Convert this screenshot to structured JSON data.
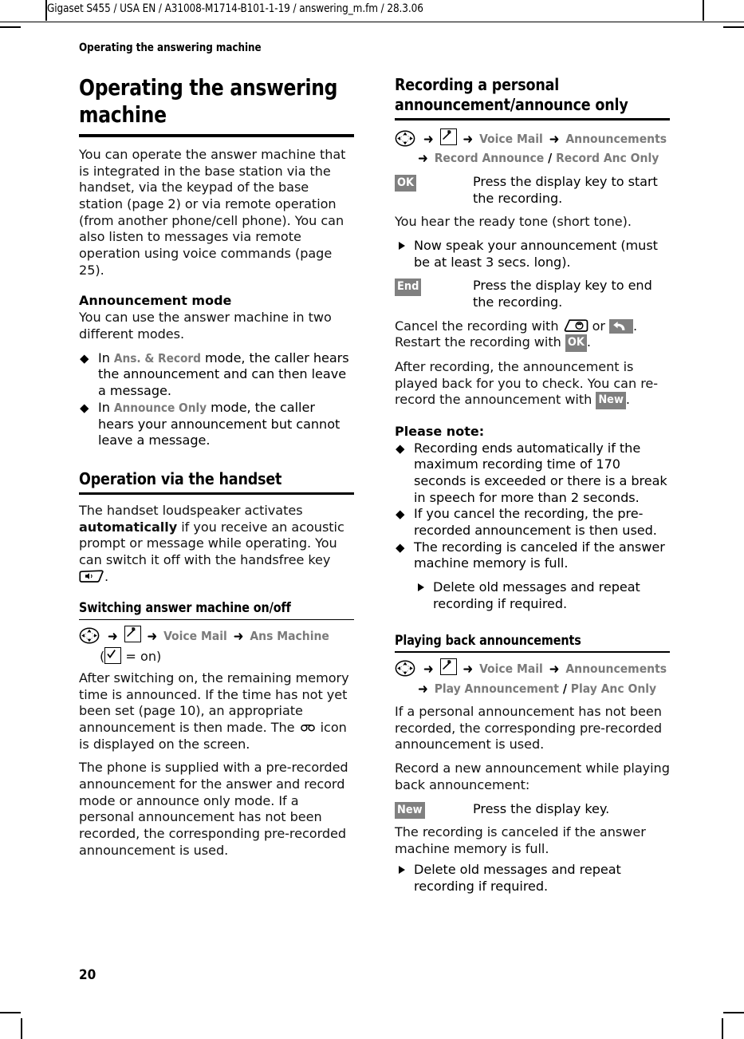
{
  "runhead": {
    "text": "Gigaset S455 / USA EN / A31008-M1714-B101-1-19  / answering_m.fm / 28.3.06"
  },
  "chapter": "Operating the answering machine",
  "folio": "20",
  "left_column": {
    "h1": "Operating the answering machine",
    "intro": "You can operate the answer machine that is integrated in the base station via the handset, via the keypad of the base station (page 2) or via remote operation (from another phone/cell phone). You can also listen to messages via remote operation using voice commands (page 25).",
    "announcement_mode": {
      "heading": "Announcement mode",
      "intro": "You can use the answer machine in two different modes.",
      "bullets": [
        {
          "pre": "In ",
          "ui": "Ans. & Record",
          "post": " mode, the caller hears the announcement and can then leave a message."
        },
        {
          "pre": "In ",
          "ui": "Announce Only",
          "post": " mode, the caller hears your announcement but cannot leave a message."
        }
      ]
    },
    "handset_section": {
      "heading": "Operation via the handset",
      "para_a": "The handset loudspeaker activates ",
      "para_a_bold": "automatically",
      "para_a_cont": " if you receive an acoustic prompt or message while operating. You can switch it off with the handsfree key ",
      "para_a_end": "."
    },
    "switching_section": {
      "heading": "Switching answer machine on/off",
      "menupath": {
        "item1": "Voice Mail",
        "item2": "Ans Machine",
        "note_open": "(",
        "note_text": " = on)"
      },
      "para_b_1": "After switching on, the remaining memory time is announced. If the time has not yet been set (page 10), an appropriate announcement is then made. The ",
      "para_b_2": " icon is displayed on the screen.",
      "para_c": "The phone is supplied with a pre-recorded announcement for the answer and record mode or announce only mode. If a personal announcement has not been recorded, the corresponding pre-recorded announcement is used."
    }
  },
  "right_column": {
    "recording_section": {
      "heading": "Recording a personal announcement/announce only",
      "menupath": {
        "item1": "Voice Mail",
        "item2": "Announcements",
        "item3": "Record Announce",
        "slash": " / ",
        "item4": "Record Anc Only"
      },
      "key_ok": "OK",
      "key_ok_desc": "Press the display key to start the recording.",
      "ready_tone": "You hear the ready tone (short tone).",
      "step_speak": "Now speak your announcement (must be at least 3 secs. long).",
      "key_end": "End",
      "key_end_desc": "Press the display key to end the recording.",
      "cancel_1": "Cancel the recording with ",
      "cancel_2": " or ",
      "cancel_3": ". Restart the recording with ",
      "key_ok_inline": "OK",
      "cancel_4": ".",
      "after_1": "After recording, the announcement is played back for you to check. You can re-record the announcement with ",
      "key_new_inline": "New",
      "after_2": "."
    },
    "please_note": {
      "heading": "Please note:",
      "bullets": [
        "Recording ends automatically if the maximum recording time of 170 seconds is exceeded or there is a break in speech for more than 2 seconds.",
        "If you cancel the recording, the pre-recorded announcement is then used.",
        "The recording is canceled if the answer machine memory is full."
      ],
      "substep": "Delete old messages and repeat recording if required."
    },
    "playback_section": {
      "heading": "Playing back announcements",
      "menupath": {
        "item1": "Voice Mail",
        "item2": "Announcements",
        "item3": "Play Announcement",
        "slash": " / ",
        "item4": "Play Anc Only"
      },
      "para_a": "If a personal announcement has not been recorded, the corresponding pre-recorded announcement is used.",
      "para_b": "Record a new announcement while playing back announcement:",
      "key_new": "New",
      "key_new_desc": "Press the display key.",
      "para_c": "The recording is canceled if the answer machine memory is full.",
      "step_delete": "Delete old messages and repeat recording if required."
    }
  },
  "colors": {
    "ui_label_gray": "#7b7b7b",
    "display_key_gray": "#808080",
    "rule_black": "#000000"
  }
}
